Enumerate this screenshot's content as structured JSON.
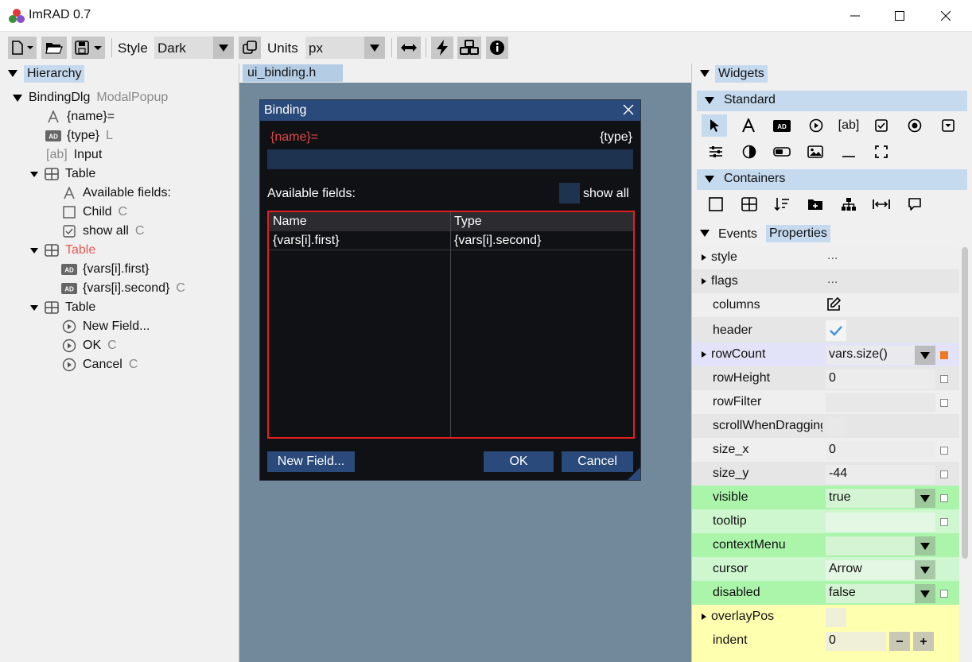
{
  "window": {
    "title": "ImRAD 0.7",
    "controls": [
      "minimize",
      "maximize",
      "close"
    ]
  },
  "toolbar": {
    "style_label": "Style",
    "style_value": "Dark",
    "units_label": "Units",
    "units_value": "px",
    "icons": [
      "new-file-icon",
      "open-folder-icon",
      "save-icon",
      "clone-style-icon",
      "resize-horizontal-icon",
      "bolt-icon",
      "cubes-icon",
      "info-icon"
    ]
  },
  "hierarchy": {
    "tab": "Hierarchy",
    "items": [
      {
        "label": "BindingDlg",
        "suffix": "ModalPopup"
      },
      {
        "label": "{name}="
      },
      {
        "label": "{type}",
        "suffix": "L"
      },
      {
        "prefix": "[ab]",
        "label": "Input"
      },
      {
        "label": "Table"
      },
      {
        "label": "Available fields:"
      },
      {
        "label": "Child",
        "suffix": "C"
      },
      {
        "label": "show all",
        "suffix": "C"
      },
      {
        "label": "Table"
      },
      {
        "label": "{vars[i].first}"
      },
      {
        "label": "{vars[i].second}",
        "suffix": "C"
      },
      {
        "label": "Table"
      },
      {
        "label": "New Field..."
      },
      {
        "label": "OK",
        "suffix": "C"
      },
      {
        "label": "Cancel",
        "suffix": "C"
      }
    ],
    "selected_color": "#e85a50"
  },
  "editor": {
    "file_tab": "ui_binding.h"
  },
  "dialog": {
    "title": "Binding",
    "name_text": "{name}=",
    "type_text": "{type}",
    "input_value": "",
    "fields_label": "Available fields:",
    "show_all_label": "show all",
    "table": {
      "headers": [
        "Name",
        "Type"
      ],
      "rows": [
        [
          "{vars[i].first}",
          "{vars[i].second}"
        ]
      ]
    },
    "new_field_button": "New Field...",
    "ok_button": "OK",
    "cancel_button": "Cancel",
    "accent_red": "#e0484a"
  },
  "widgets": {
    "tab": "Widgets",
    "standard_label": "Standard",
    "containers_label": "Containers",
    "input_text_glyph": "[ab]"
  },
  "properties": {
    "tabs": [
      "Events",
      "Properties"
    ],
    "rows": [
      {
        "name": "style",
        "value": "..."
      },
      {
        "name": "flags",
        "value": "..."
      },
      {
        "name": "columns",
        "value": ""
      },
      {
        "name": "header",
        "value": ""
      },
      {
        "name": "rowCount",
        "value": "vars.size()"
      },
      {
        "name": "rowHeight",
        "value": "0"
      },
      {
        "name": "rowFilter",
        "value": ""
      },
      {
        "name": "scrollWhenDragging",
        "value": ""
      },
      {
        "name": "size_x",
        "value": "0"
      },
      {
        "name": "size_y",
        "value": "-44"
      },
      {
        "name": "visible",
        "value": "true"
      },
      {
        "name": "tooltip",
        "value": ""
      },
      {
        "name": "contextMenu",
        "value": ""
      },
      {
        "name": "cursor",
        "value": "Arrow"
      },
      {
        "name": "disabled",
        "value": "false"
      },
      {
        "name": "overlayPos",
        "value": ""
      },
      {
        "name": "indent",
        "value": "0"
      }
    ],
    "colors": {
      "green": "#aaf5aa",
      "light_green": "#cff7cf",
      "yellow": "#ffffb0",
      "lilac": "#e2e2f8",
      "orange": "#f0781e"
    }
  }
}
